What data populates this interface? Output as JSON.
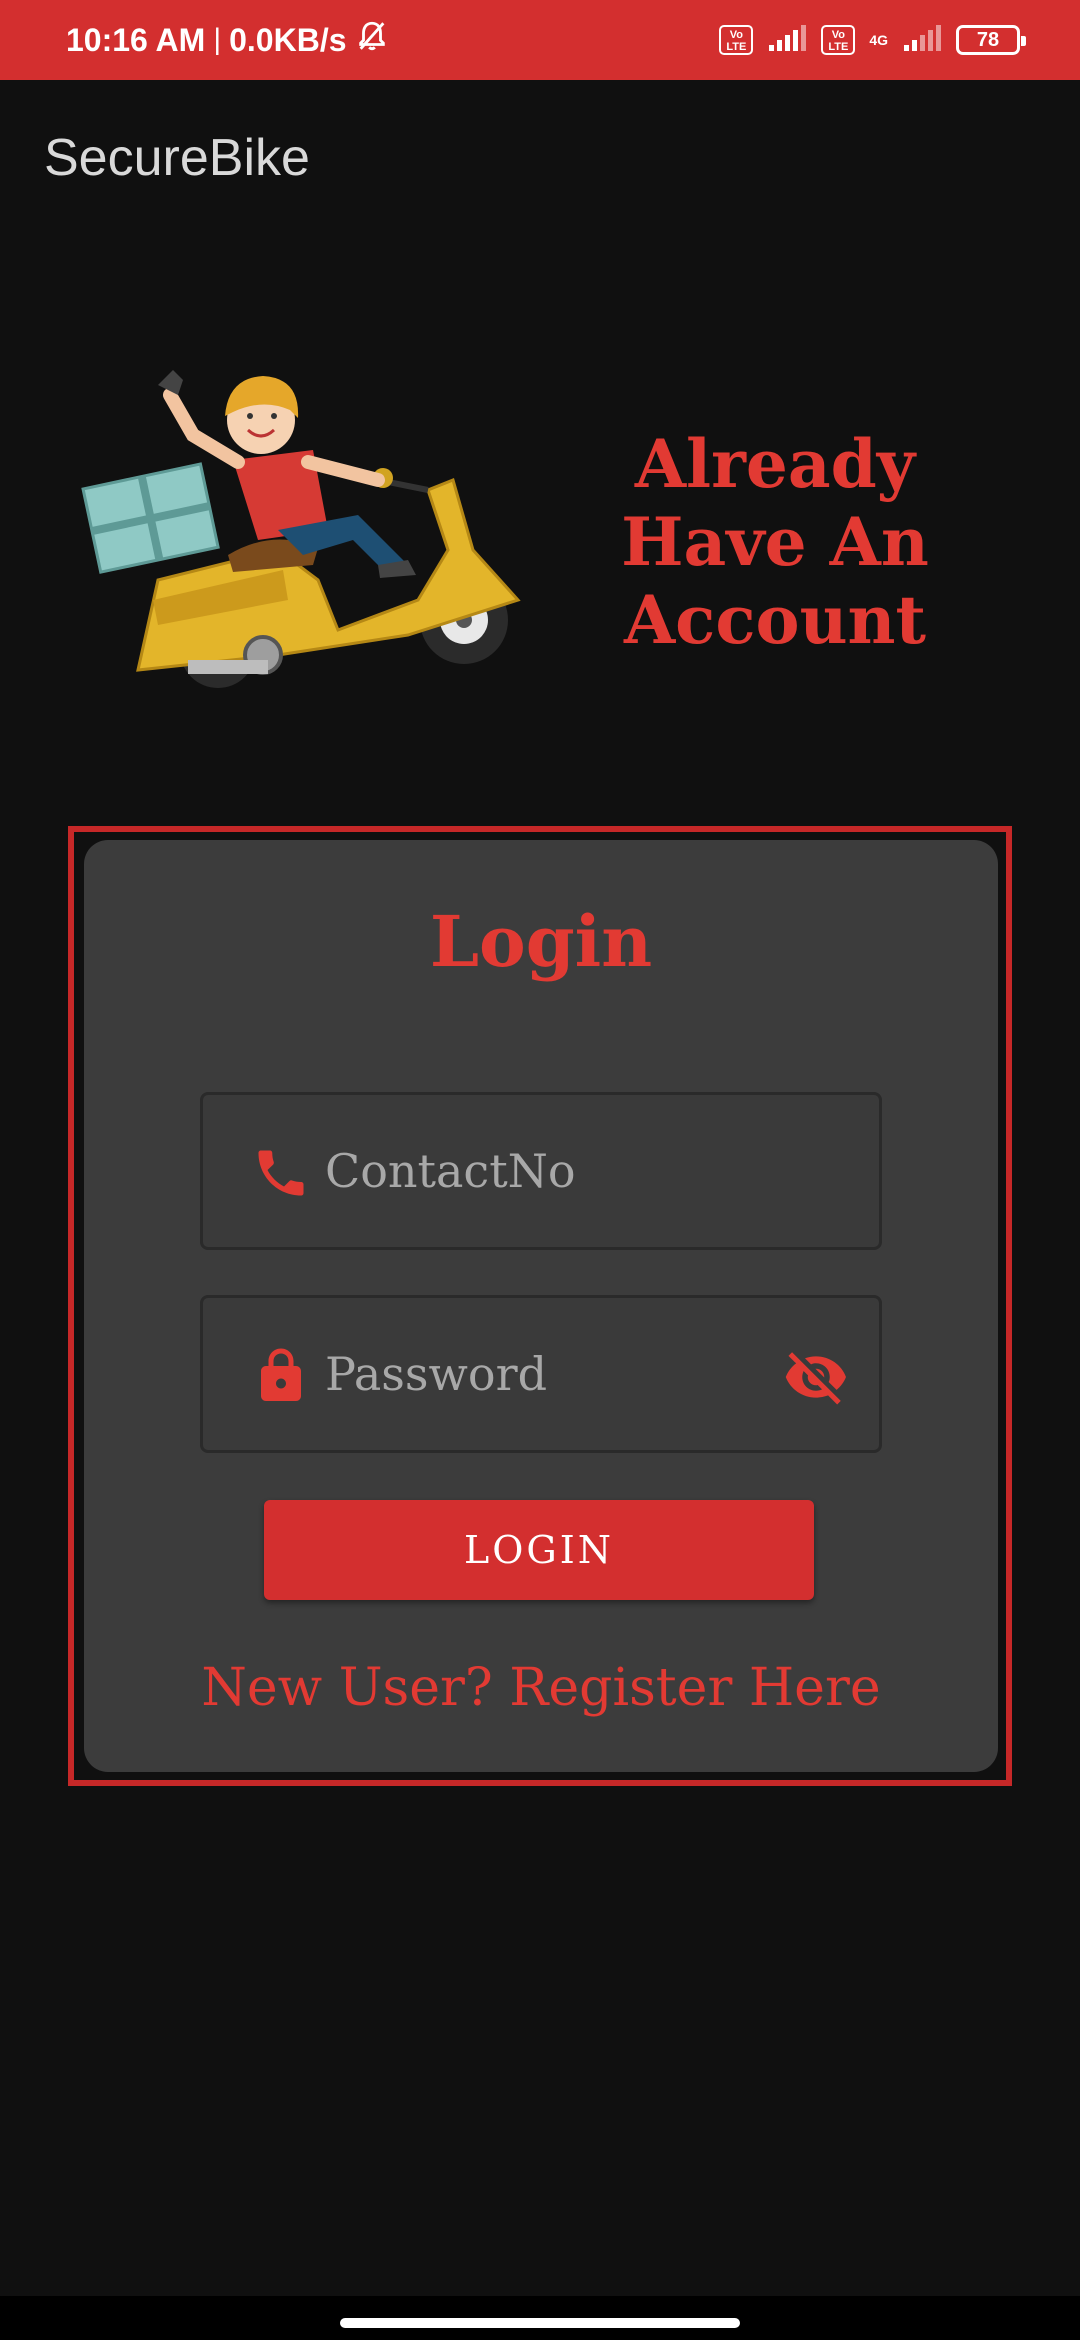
{
  "status_bar": {
    "time": "10:16 AM",
    "separator": "|",
    "net_speed": "0.0KB/s",
    "volte_1": "Vo LTE",
    "volte_2": "Vo LTE",
    "network_type": "4G",
    "battery_level": "78",
    "icons": [
      "mute-icon",
      "volte-icon",
      "signal-icon",
      "volte-icon",
      "signal-icon",
      "battery-icon"
    ]
  },
  "app_bar": {
    "title": "SecureBike"
  },
  "hero": {
    "heading": "Already Have An Account"
  },
  "login_card": {
    "title": "Login",
    "contact_field": {
      "placeholder": "ContactNo",
      "value": "",
      "icon": "phone-icon"
    },
    "password_field": {
      "placeholder": "Password",
      "value": "",
      "icon": "lock-icon",
      "toggle_icon": "visibility-off-icon"
    },
    "login_button": "LOGIN",
    "register_link": "New User? Register Here"
  },
  "colors": {
    "accent": "#d32f2f",
    "accent_text": "#e23a33",
    "background": "#101010",
    "card": "#3c3c3c"
  }
}
